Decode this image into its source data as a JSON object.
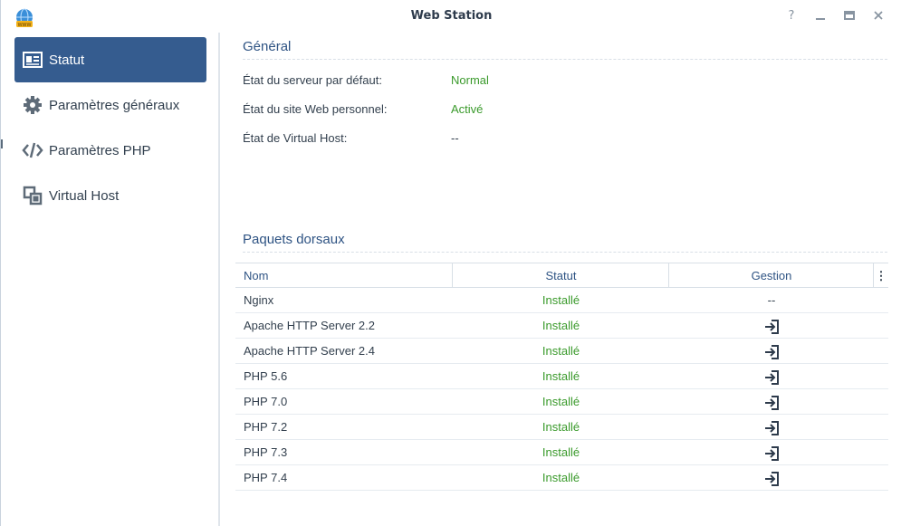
{
  "window": {
    "title": "Web Station",
    "controls": {
      "help": "?",
      "minimize": "—",
      "maximize": "▭",
      "close": "✕"
    }
  },
  "sidebar": {
    "items": [
      {
        "label": "Statut",
        "icon": "status-card-icon",
        "active": true
      },
      {
        "label": "Paramètres généraux",
        "icon": "gear-icon",
        "active": false
      },
      {
        "label": "Paramètres PHP",
        "icon": "code-icon",
        "active": false
      },
      {
        "label": "Virtual Host",
        "icon": "virtual-host-icon",
        "active": false
      }
    ]
  },
  "general": {
    "title": "Général",
    "rows": [
      {
        "label": "État du serveur par défaut:",
        "value": "Normal"
      },
      {
        "label": "État du site Web personnel:",
        "value": "Activé"
      },
      {
        "label": "État de Virtual Host:",
        "value": "--"
      }
    ]
  },
  "packages": {
    "title": "Paquets dorsaux",
    "columns": [
      "Nom",
      "Statut",
      "Gestion"
    ],
    "menu_icon": "⋮",
    "rows": [
      {
        "name": "Nginx",
        "status": "Installé",
        "manage": "--"
      },
      {
        "name": "Apache HTTP Server 2.2",
        "status": "Installé",
        "manage": "open-icon"
      },
      {
        "name": "Apache HTTP Server 2.4",
        "status": "Installé",
        "manage": "open-icon"
      },
      {
        "name": "PHP 5.6",
        "status": "Installé",
        "manage": "open-icon"
      },
      {
        "name": "PHP 7.0",
        "status": "Installé",
        "manage": "open-icon"
      },
      {
        "name": "PHP 7.2",
        "status": "Installé",
        "manage": "open-icon"
      },
      {
        "name": "PHP 7.3",
        "status": "Installé",
        "manage": "open-icon"
      },
      {
        "name": "PHP 7.4",
        "status": "Installé",
        "manage": "open-icon"
      }
    ]
  },
  "colors": {
    "accent": "#355c8f",
    "section_title": "#2e5383",
    "status_green": "#3a9a2b"
  }
}
